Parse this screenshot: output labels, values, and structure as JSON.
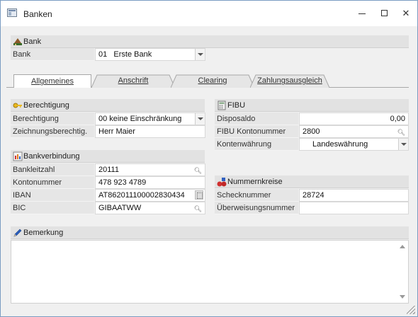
{
  "window": {
    "title": "Banken",
    "icons": {
      "app": "window-app-icon",
      "minimize": "minimize-icon",
      "maximize": "maximize-icon",
      "close": "close-icon"
    }
  },
  "bank_section": {
    "header": "Bank",
    "icon": "bank-icon",
    "label": "Bank",
    "value": "01   Erste Bank"
  },
  "tabs": [
    {
      "label": "Allgemeines",
      "active": true
    },
    {
      "label": "Anschrift",
      "active": false
    },
    {
      "label": "Clearing",
      "active": false
    },
    {
      "label": "Zahlungsausgleich",
      "active": false
    }
  ],
  "berechtigung": {
    "header": "Berechtigung",
    "icon": "key-icon",
    "rows": [
      {
        "label": "Berechtigung",
        "value": "00 keine Einschränkung"
      },
      {
        "label": "Zeichnungsberechtig.",
        "value": "Herr Maier"
      }
    ]
  },
  "bankverbindung": {
    "header": "Bankverbindung",
    "icon": "bank-connection-icon",
    "rows": [
      {
        "label": "Bankleitzahl",
        "value": "20111"
      },
      {
        "label": "Kontonummer",
        "value": "478 923 4789"
      },
      {
        "label": "IBAN",
        "value": "AT862011100002830434"
      },
      {
        "label": "BIC",
        "value": "GIBAATWW"
      }
    ]
  },
  "fibu": {
    "header": "FIBU",
    "icon": "fibu-icon",
    "rows": [
      {
        "label": "Disposaldo",
        "value": "0,00"
      },
      {
        "label": "FIBU Kontonummer",
        "value": "2800"
      },
      {
        "label": "Kontenwährung",
        "value": "Landeswährung"
      }
    ]
  },
  "nummernkreise": {
    "header": "Nummernkreise",
    "icon": "number-range-icon",
    "rows": [
      {
        "label": "Schecknummer",
        "value": "28724"
      },
      {
        "label": "Überweisungsnummer",
        "value": ""
      }
    ]
  },
  "bemerkung": {
    "header": "Bemerkung",
    "icon": "pencil-icon",
    "value": ""
  }
}
